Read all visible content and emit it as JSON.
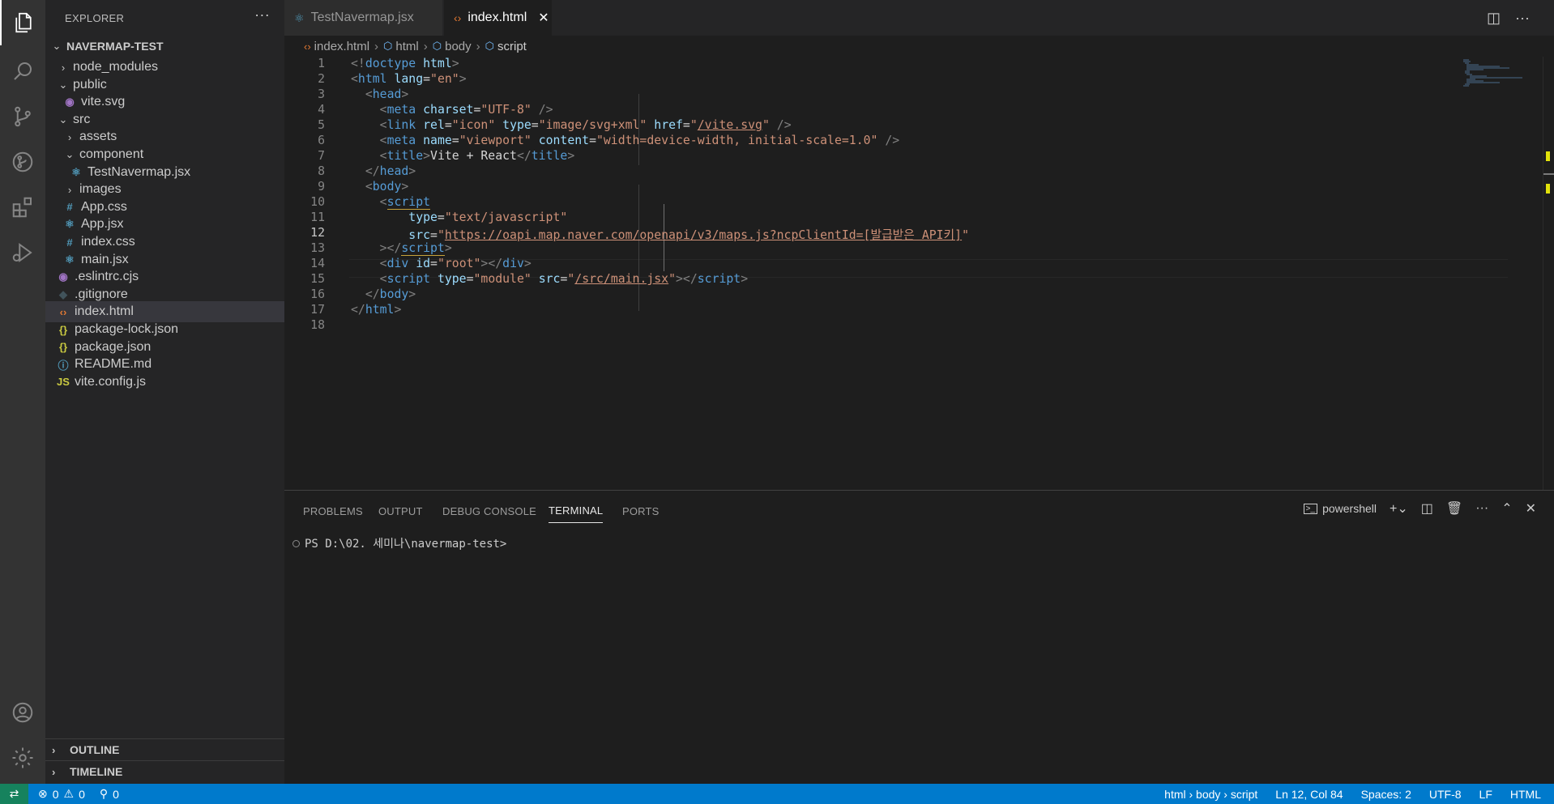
{
  "activity_bar": {
    "icons": [
      "files-icon",
      "search-icon",
      "source-control-icon",
      "run-debug-icon",
      "extensions-icon",
      "testing-icon",
      "accounts-icon",
      "settings-gear-icon"
    ]
  },
  "sidebar": {
    "title": "EXPLORER",
    "more": "···",
    "root": "NAVERMAP-TEST",
    "items": [
      {
        "label": "node_modules",
        "type": "folder",
        "open": false
      },
      {
        "label": "public",
        "type": "folder",
        "open": true
      },
      {
        "label": "vite.svg",
        "type": "svg"
      },
      {
        "label": "src",
        "type": "folder",
        "open": true
      },
      {
        "label": "assets",
        "type": "folder",
        "open": false
      },
      {
        "label": "component",
        "type": "folder",
        "open": true
      },
      {
        "label": "TestNavermap.jsx",
        "type": "react"
      },
      {
        "label": "images",
        "type": "folder",
        "open": false
      },
      {
        "label": "App.css",
        "type": "css"
      },
      {
        "label": "App.jsx",
        "type": "react"
      },
      {
        "label": "index.css",
        "type": "css"
      },
      {
        "label": "main.jsx",
        "type": "react"
      },
      {
        "label": ".eslintrc.cjs",
        "type": "eslint"
      },
      {
        "label": ".gitignore",
        "type": "git"
      },
      {
        "label": "index.html",
        "type": "html"
      },
      {
        "label": "package-lock.json",
        "type": "json"
      },
      {
        "label": "package.json",
        "type": "json"
      },
      {
        "label": "README.md",
        "type": "info"
      },
      {
        "label": "vite.config.js",
        "type": "js"
      }
    ],
    "outline": "OUTLINE",
    "timeline": "TIMELINE"
  },
  "tabs": [
    {
      "label": "TestNavermap.jsx",
      "active": false
    },
    {
      "label": "index.html",
      "active": true
    }
  ],
  "breadcrumb": [
    "index.html",
    "html",
    "body",
    "script"
  ],
  "code": {
    "current_line": 12,
    "line_numbers": [
      "1",
      "2",
      "3",
      "4",
      "5",
      "6",
      "7",
      "8",
      "9",
      "10",
      "11",
      "12",
      "13",
      "14",
      "15",
      "16",
      "17",
      "18"
    ]
  },
  "panel": {
    "tabs": [
      "PROBLEMS",
      "OUTPUT",
      "DEBUG CONSOLE",
      "TERMINAL",
      "PORTS"
    ],
    "active_tab": "TERMINAL",
    "shell": "powershell",
    "prompt": "PS D:\\02. 세미나\\navermap-test>"
  },
  "status": {
    "errors": "0",
    "warnings": "0",
    "ports": "0",
    "breadcrumb": "html › body › script",
    "position": "Ln 12, Col 84",
    "spaces": "Spaces: 2",
    "encoding": "UTF-8",
    "eol": "LF",
    "language": "HTML"
  },
  "colors": {
    "status_bar": "#007acc",
    "remote": "#16825d",
    "tag": "#569cd6",
    "attribute": "#9cdcfe",
    "string": "#ce9178"
  }
}
